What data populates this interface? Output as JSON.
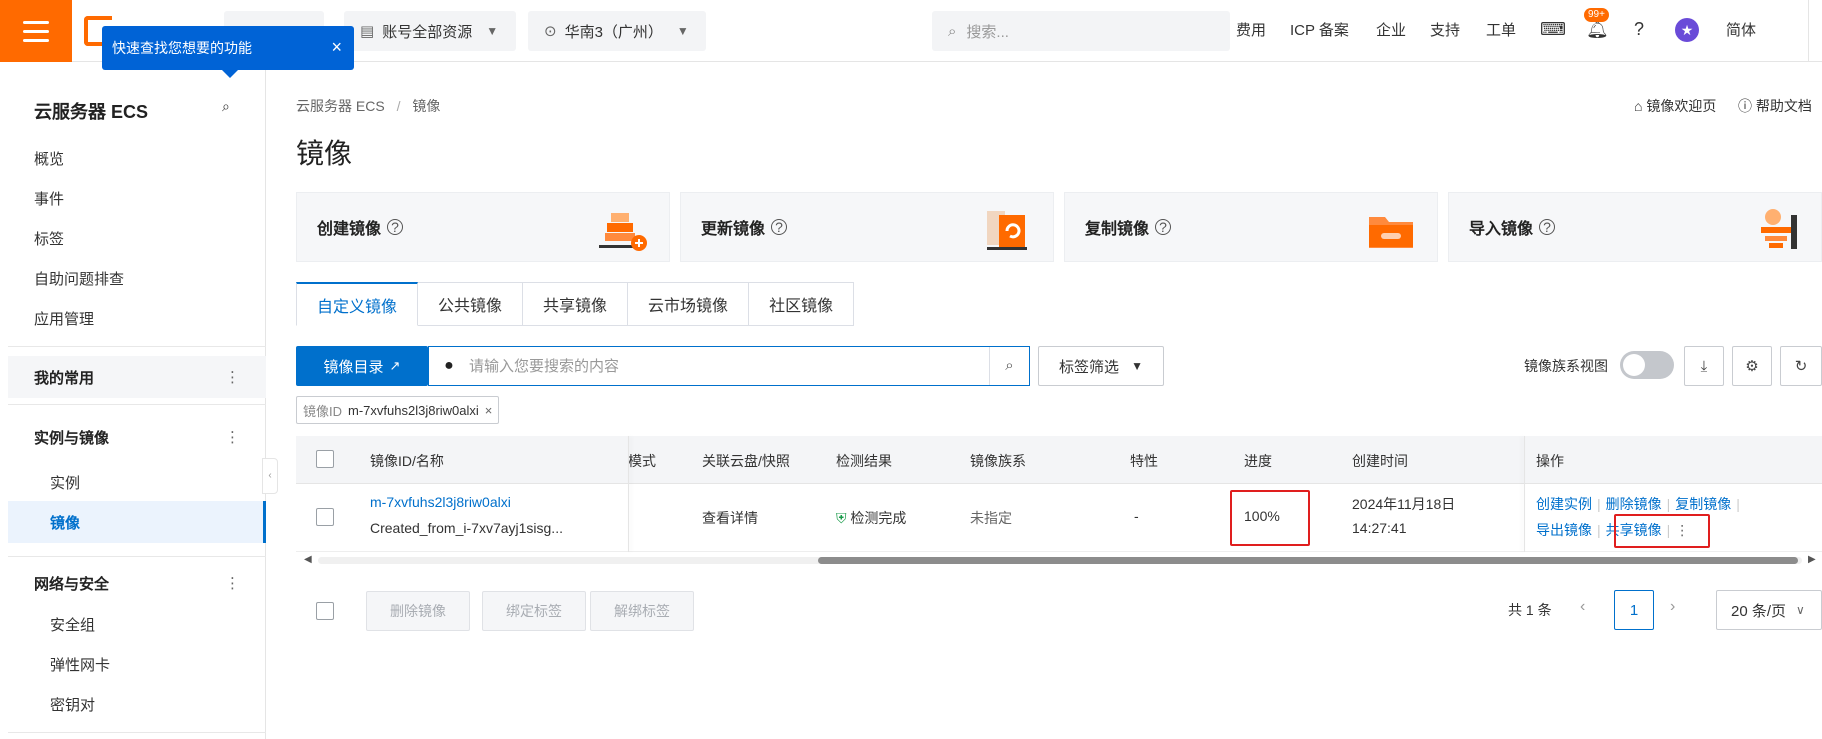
{
  "topbar": {
    "account_scope": "账号全部资源",
    "region": "华南3（广州）",
    "search_placeholder": "搜索...",
    "links": [
      "费用",
      "ICP 备案",
      "企业",
      "支持",
      "工单"
    ],
    "notification_badge": "99+",
    "language": "简体"
  },
  "tooltip": {
    "text": "快速查找您想要的功能",
    "close": "×"
  },
  "sidebar": {
    "title": "云服务器 ECS",
    "top_items": [
      "概览",
      "事件",
      "标签",
      "自助问题排查",
      "应用管理"
    ],
    "group_favorites": "我的常用",
    "group_instances": "实例与镜像",
    "instances_items": [
      "实例",
      "镜像"
    ],
    "group_network": "网络与安全",
    "network_items": [
      "安全组",
      "弹性网卡",
      "密钥对"
    ],
    "group_more_icon": "⋮"
  },
  "breadcrumb": {
    "root": "云服务器 ECS",
    "sep": "/",
    "current": "镜像"
  },
  "page": {
    "title": "镜像",
    "welcome_link": "镜像欢迎页",
    "help_link": "帮助文档"
  },
  "cards": [
    {
      "label": "创建镜像"
    },
    {
      "label": "更新镜像"
    },
    {
      "label": "复制镜像"
    },
    {
      "label": "导入镜像"
    }
  ],
  "tabs": [
    "自定义镜像",
    "公共镜像",
    "共享镜像",
    "云市场镜像",
    "社区镜像"
  ],
  "toolbar": {
    "catalog_button": "镜像目录",
    "search_placeholder": "请输入您要搜索的内容",
    "tag_filter": "标签筛选",
    "family_view": "镜像族系视图"
  },
  "filter_tag": {
    "key": "镜像ID",
    "value": "m-7xvfuhs2l3j8riw0alxi",
    "remove": "×"
  },
  "table": {
    "headers": {
      "id_name": "镜像ID/名称",
      "mode": "模式",
      "disk_snapshot": "关联云盘/快照",
      "check": "检测结果",
      "family": "镜像族系",
      "feature": "特性",
      "progress": "进度",
      "created": "创建时间",
      "ops": "操作"
    },
    "row": {
      "id": "m-7xvfuhs2l3j8riw0alxi",
      "name": "Created_from_i-7xv7ayj1sisg...",
      "disk_snapshot": "查看详情",
      "check": "检测完成",
      "family": "未指定",
      "feature": "-",
      "progress": "100%",
      "created_date": "2024年11月18日",
      "created_time": "14:27:41",
      "ops": {
        "create_instance": "创建实例",
        "delete": "删除镜像",
        "copy": "复制镜像",
        "export": "导出镜像",
        "share": "共享镜像"
      }
    }
  },
  "bulk": {
    "delete": "删除镜像",
    "bind_tag": "绑定标签",
    "unbind_tag": "解绑标签"
  },
  "pager": {
    "total": "共 1 条",
    "page": "1",
    "size": "20 条/页"
  },
  "colors": {
    "brand": "#ff6a00",
    "primary": "#0070cc",
    "highlight": "#e01e1e",
    "success": "#1a9b4a"
  }
}
